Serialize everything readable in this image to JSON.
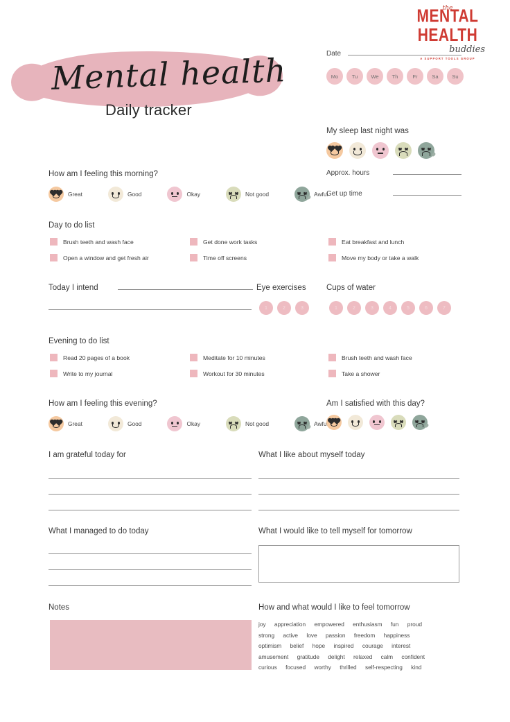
{
  "logo": {
    "the": "the",
    "main": "MENTAL HEALTH",
    "script": "buddies",
    "tagline": "A SUPPORT TOOLS GROUP"
  },
  "title": {
    "script": "Mental health",
    "sub": "Daily tracker"
  },
  "date": {
    "label": "Date"
  },
  "days": [
    "Mo",
    "Tu",
    "We",
    "Th",
    "Fr",
    "Sa",
    "Su"
  ],
  "sleep": {
    "heading": "My sleep last night was",
    "approx_hours_label": "Approx. hours",
    "get_up_time_label": "Get up time"
  },
  "morning": {
    "heading": "How am I feeling this morning?",
    "options": [
      "Great",
      "Good",
      "Okay",
      "Not good",
      "Awful"
    ]
  },
  "evening_mood": {
    "heading": "How am I feeling this evening?",
    "options": [
      "Great",
      "Good",
      "Okay",
      "Not good",
      "Awful"
    ]
  },
  "satisfied": {
    "heading": "Am I satisfied with this day?"
  },
  "day_todo": {
    "heading": "Day to do list",
    "col1": [
      "Brush teeth and wash face",
      "Open a window and get fresh air"
    ],
    "col2": [
      "Get done work tasks",
      "Time off screens"
    ],
    "col3": [
      "Eat breakfast and lunch",
      "Move my body or take a walk"
    ]
  },
  "evening_todo": {
    "heading": "Evening to do list",
    "col1": [
      "Read 20 pages of a book",
      "Write to my journal"
    ],
    "col2": [
      "Meditate for 10 minutes",
      "Workout for 30 minutes"
    ],
    "col3": [
      "Brush teeth and wash face",
      "Take a shower"
    ]
  },
  "intend": {
    "label": "Today I intend"
  },
  "eye_exercises": {
    "label": "Eye exercises",
    "counts": [
      "1",
      "2",
      "3"
    ]
  },
  "water": {
    "label": "Cups of water",
    "counts": [
      "1",
      "2",
      "3",
      "4",
      "5",
      "6",
      "7"
    ]
  },
  "grateful": {
    "heading": "I am grateful today for"
  },
  "like_myself": {
    "heading": "What I like about myself today"
  },
  "managed": {
    "heading": "What I managed to do today"
  },
  "tell_tomorrow": {
    "heading": "What I would like to tell myself for tomorrow"
  },
  "notes": {
    "heading": "Notes"
  },
  "feel_tomorrow": {
    "heading": "How and what would I like to feel tomorrow",
    "rows": [
      [
        "joy",
        "appreciation",
        "empowered",
        "enthusiasm",
        "fun",
        "proud"
      ],
      [
        "strong",
        "active",
        "love",
        "passion",
        "freedom",
        "happiness"
      ],
      [
        "optimism",
        "belief",
        "hope",
        "inspired",
        "courage",
        "interest"
      ],
      [
        "amusement",
        "gratitude",
        "delight",
        "relaxed",
        "calm",
        "confident"
      ],
      [
        "curious",
        "focused",
        "worthy",
        "thrilled",
        "self-respecting",
        "kind"
      ]
    ]
  },
  "colors": {
    "brush_pink": "#e7b4bc",
    "checkbox_pink": "#eeb7bd",
    "circle_pink": "#eebcc2",
    "notes_pink": "#e8bcc1",
    "face_great": "#f5c9a0",
    "face_good": "#f2e9d8",
    "face_okay": "#f0c6d0",
    "face_notgood": "#d9dcbb",
    "face_awful": "#8fa69b",
    "logo_red": "#cf3b33"
  }
}
